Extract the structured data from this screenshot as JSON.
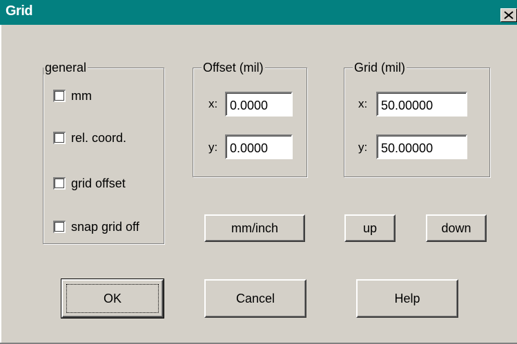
{
  "window": {
    "title": "Grid"
  },
  "general": {
    "legend": "general",
    "checkboxes": [
      {
        "label": "mm",
        "checked": false
      },
      {
        "label": "rel. coord.",
        "checked": false
      },
      {
        "label": "grid offset",
        "checked": false
      },
      {
        "label": "snap grid off",
        "checked": false
      }
    ]
  },
  "offset": {
    "legend": "Offset  (mil)",
    "x_label": "x:",
    "x_value": "0.0000",
    "y_label": "y:",
    "y_value": "0.0000"
  },
  "grid": {
    "legend": "Grid  (mil)",
    "x_label": "x:",
    "x_value": "50.00000",
    "y_label": "y:",
    "y_value": "50.00000"
  },
  "buttons": {
    "mm_inch": "mm/inch",
    "up": "up",
    "down": "down",
    "ok": "OK",
    "cancel": "Cancel",
    "help": "Help"
  },
  "icons": {
    "close": "close-icon"
  },
  "colors": {
    "titlebar": "#038080",
    "face": "#d4d0c8"
  }
}
